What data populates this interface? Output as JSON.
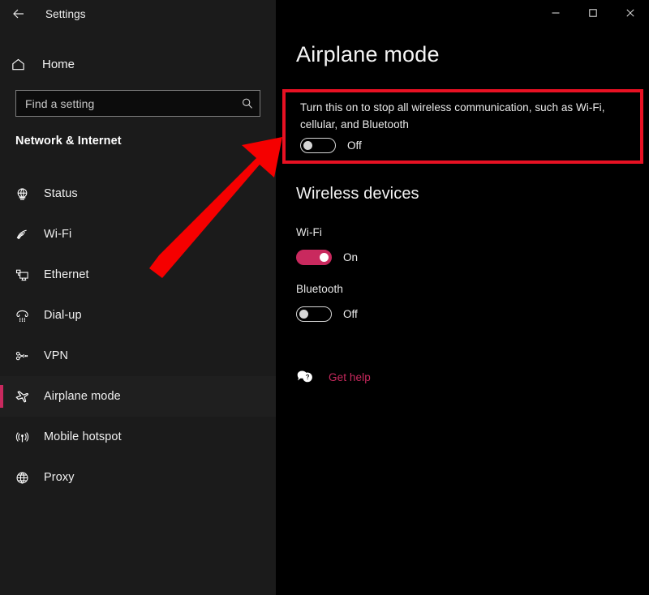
{
  "window": {
    "app_title": "Settings",
    "back_icon": "back-arrow-icon",
    "controls": {
      "minimize": "minimize-icon",
      "maximize": "maximize-icon",
      "close": "close-icon"
    }
  },
  "sidebar": {
    "home_label": "Home",
    "home_icon": "home-icon",
    "search": {
      "placeholder": "Find a setting",
      "value": "",
      "icon": "search-icon"
    },
    "category": "Network & Internet",
    "items": [
      {
        "label": "Status",
        "icon": "globe-status-icon",
        "selected": false
      },
      {
        "label": "Wi-Fi",
        "icon": "wifi-icon",
        "selected": false
      },
      {
        "label": "Ethernet",
        "icon": "ethernet-icon",
        "selected": false
      },
      {
        "label": "Dial-up",
        "icon": "dialup-phone-icon",
        "selected": false
      },
      {
        "label": "VPN",
        "icon": "vpn-icon",
        "selected": false
      },
      {
        "label": "Airplane mode",
        "icon": "airplane-icon",
        "selected": true
      },
      {
        "label": "Mobile hotspot",
        "icon": "hotspot-icon",
        "selected": false
      },
      {
        "label": "Proxy",
        "icon": "globe-proxy-icon",
        "selected": false
      }
    ]
  },
  "main": {
    "page_title": "Airplane mode",
    "description": "Turn this on to stop all wireless communication, such as Wi-Fi, cellular, and Bluetooth",
    "airplane_toggle": {
      "state": "Off",
      "on": false
    },
    "wireless_heading": "Wireless devices",
    "devices": [
      {
        "label": "Wi-Fi",
        "state": "On",
        "on": true
      },
      {
        "label": "Bluetooth",
        "state": "Off",
        "on": false
      }
    ],
    "get_help": {
      "label": "Get help",
      "icon": "help-bubble-icon"
    }
  },
  "annotations": {
    "highlight_color": "#e81123",
    "arrow_color": "#f50000",
    "accent_color": "#c9295e"
  }
}
